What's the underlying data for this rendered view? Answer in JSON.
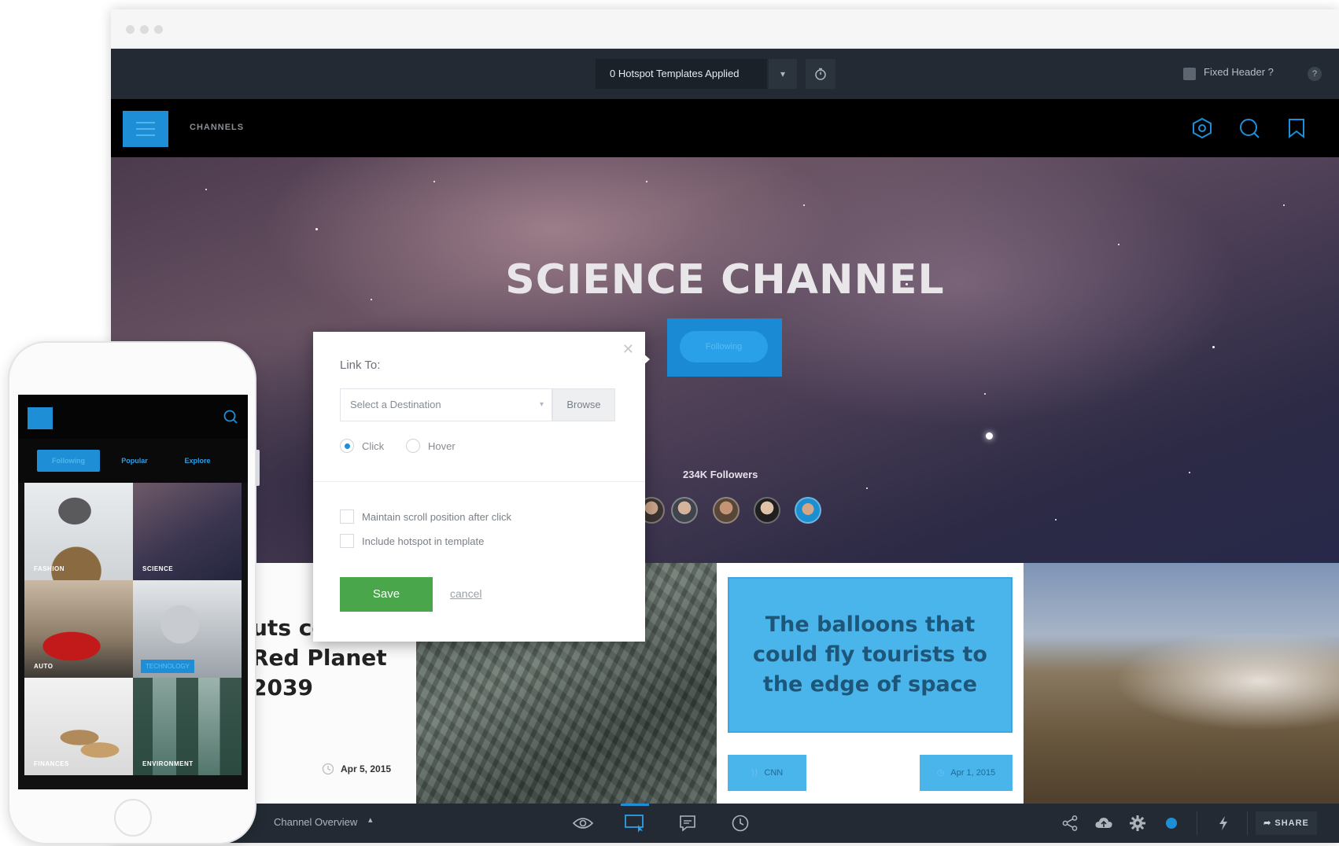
{
  "toolbar": {
    "templates_label": "0 Hotspot Templates Applied",
    "fixed_header_label": "Fixed Header ?",
    "help_label": "?"
  },
  "app": {
    "channels_label": "CHANNELS",
    "hero_title": "SCIENCE CHANNEL",
    "follow_button_label": "Following",
    "followers_label": "234K Followers"
  },
  "cards": {
    "article_headline": "uts co\nRed Planet\n2039",
    "article_date": "Apr 5, 2015",
    "news_title": "The balloons that could fly tourists to the edge of space",
    "news_source": "CNN",
    "news_date": "Apr 1, 2015"
  },
  "bottom_bar": {
    "page_label": "Channel Overview",
    "share_label": "SHARE"
  },
  "modal": {
    "title": "Link To:",
    "destination_placeholder": "Select a Destination",
    "browse_label": "Browse",
    "click_label": "Click",
    "hover_label": "Hover",
    "selected_trigger": "Click",
    "maintain_scroll_label": "Maintain scroll position after click",
    "include_hotspot_label": "Include hotspot in template",
    "save_label": "Save",
    "cancel_label": "cancel"
  },
  "phone": {
    "tabs": [
      "Following",
      "Popular",
      "Explore"
    ],
    "tiles": [
      "FASHION",
      "SCIENCE",
      "AUTO",
      "TECHNOLOGY",
      "FINANCES",
      "ENVIRONMENT"
    ]
  },
  "colors": {
    "accent_blue": "#1e8fd6",
    "save_green": "#4aa64a",
    "toolbar_dark": "#232a33"
  },
  "icons": [
    "timer-icon",
    "hexagon-icon",
    "search-icon",
    "bookmark-icon",
    "eye-icon",
    "hotspot-icon",
    "comment-icon",
    "history-icon",
    "share-network-icon",
    "cloud-icon",
    "gear-icon",
    "lightning-icon",
    "close-icon"
  ]
}
